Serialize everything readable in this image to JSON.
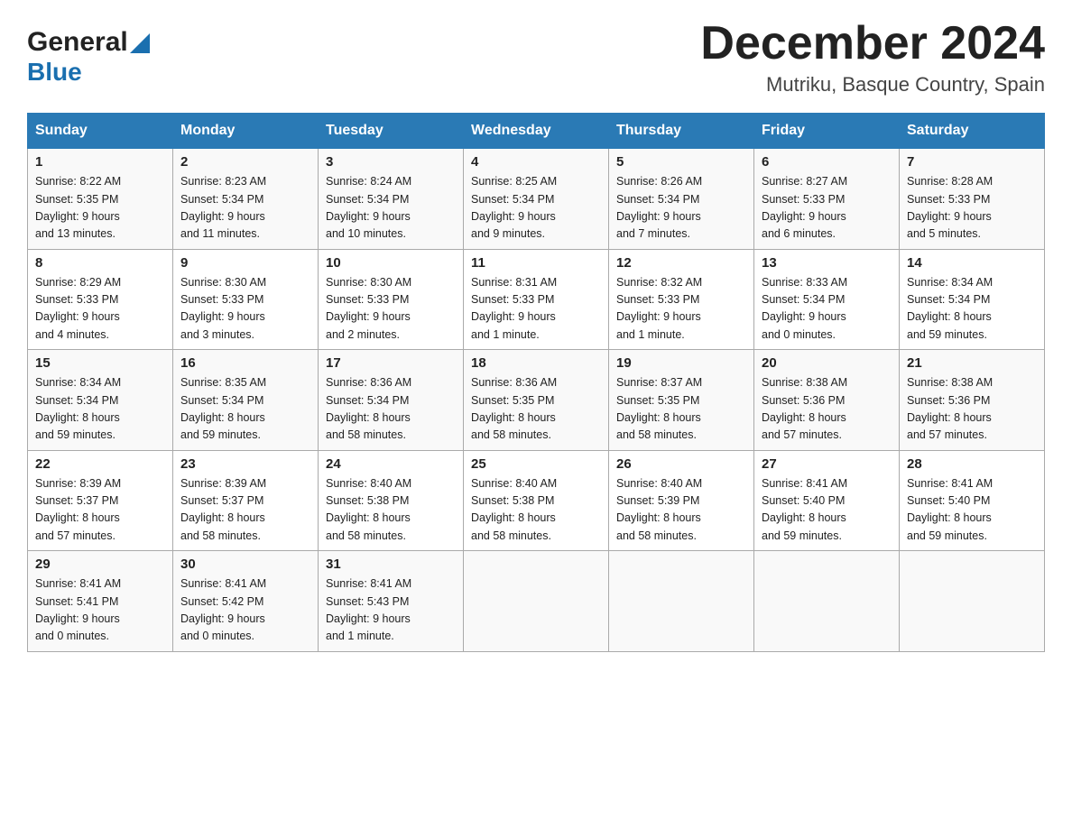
{
  "header": {
    "logo_general": "General",
    "logo_blue": "Blue",
    "month_title": "December 2024",
    "location": "Mutriku, Basque Country, Spain"
  },
  "days_of_week": [
    "Sunday",
    "Monday",
    "Tuesday",
    "Wednesday",
    "Thursday",
    "Friday",
    "Saturday"
  ],
  "weeks": [
    [
      {
        "day": "1",
        "sunrise": "8:22 AM",
        "sunset": "5:35 PM",
        "daylight": "9 hours and 13 minutes."
      },
      {
        "day": "2",
        "sunrise": "8:23 AM",
        "sunset": "5:34 PM",
        "daylight": "9 hours and 11 minutes."
      },
      {
        "day": "3",
        "sunrise": "8:24 AM",
        "sunset": "5:34 PM",
        "daylight": "9 hours and 10 minutes."
      },
      {
        "day": "4",
        "sunrise": "8:25 AM",
        "sunset": "5:34 PM",
        "daylight": "9 hours and 9 minutes."
      },
      {
        "day": "5",
        "sunrise": "8:26 AM",
        "sunset": "5:34 PM",
        "daylight": "9 hours and 7 minutes."
      },
      {
        "day": "6",
        "sunrise": "8:27 AM",
        "sunset": "5:33 PM",
        "daylight": "9 hours and 6 minutes."
      },
      {
        "day": "7",
        "sunrise": "8:28 AM",
        "sunset": "5:33 PM",
        "daylight": "9 hours and 5 minutes."
      }
    ],
    [
      {
        "day": "8",
        "sunrise": "8:29 AM",
        "sunset": "5:33 PM",
        "daylight": "9 hours and 4 minutes."
      },
      {
        "day": "9",
        "sunrise": "8:30 AM",
        "sunset": "5:33 PM",
        "daylight": "9 hours and 3 minutes."
      },
      {
        "day": "10",
        "sunrise": "8:30 AM",
        "sunset": "5:33 PM",
        "daylight": "9 hours and 2 minutes."
      },
      {
        "day": "11",
        "sunrise": "8:31 AM",
        "sunset": "5:33 PM",
        "daylight": "9 hours and 1 minute."
      },
      {
        "day": "12",
        "sunrise": "8:32 AM",
        "sunset": "5:33 PM",
        "daylight": "9 hours and 1 minute."
      },
      {
        "day": "13",
        "sunrise": "8:33 AM",
        "sunset": "5:34 PM",
        "daylight": "9 hours and 0 minutes."
      },
      {
        "day": "14",
        "sunrise": "8:34 AM",
        "sunset": "5:34 PM",
        "daylight": "8 hours and 59 minutes."
      }
    ],
    [
      {
        "day": "15",
        "sunrise": "8:34 AM",
        "sunset": "5:34 PM",
        "daylight": "8 hours and 59 minutes."
      },
      {
        "day": "16",
        "sunrise": "8:35 AM",
        "sunset": "5:34 PM",
        "daylight": "8 hours and 59 minutes."
      },
      {
        "day": "17",
        "sunrise": "8:36 AM",
        "sunset": "5:34 PM",
        "daylight": "8 hours and 58 minutes."
      },
      {
        "day": "18",
        "sunrise": "8:36 AM",
        "sunset": "5:35 PM",
        "daylight": "8 hours and 58 minutes."
      },
      {
        "day": "19",
        "sunrise": "8:37 AM",
        "sunset": "5:35 PM",
        "daylight": "8 hours and 58 minutes."
      },
      {
        "day": "20",
        "sunrise": "8:38 AM",
        "sunset": "5:36 PM",
        "daylight": "8 hours and 57 minutes."
      },
      {
        "day": "21",
        "sunrise": "8:38 AM",
        "sunset": "5:36 PM",
        "daylight": "8 hours and 57 minutes."
      }
    ],
    [
      {
        "day": "22",
        "sunrise": "8:39 AM",
        "sunset": "5:37 PM",
        "daylight": "8 hours and 57 minutes."
      },
      {
        "day": "23",
        "sunrise": "8:39 AM",
        "sunset": "5:37 PM",
        "daylight": "8 hours and 58 minutes."
      },
      {
        "day": "24",
        "sunrise": "8:40 AM",
        "sunset": "5:38 PM",
        "daylight": "8 hours and 58 minutes."
      },
      {
        "day": "25",
        "sunrise": "8:40 AM",
        "sunset": "5:38 PM",
        "daylight": "8 hours and 58 minutes."
      },
      {
        "day": "26",
        "sunrise": "8:40 AM",
        "sunset": "5:39 PM",
        "daylight": "8 hours and 58 minutes."
      },
      {
        "day": "27",
        "sunrise": "8:41 AM",
        "sunset": "5:40 PM",
        "daylight": "8 hours and 59 minutes."
      },
      {
        "day": "28",
        "sunrise": "8:41 AM",
        "sunset": "5:40 PM",
        "daylight": "8 hours and 59 minutes."
      }
    ],
    [
      {
        "day": "29",
        "sunrise": "8:41 AM",
        "sunset": "5:41 PM",
        "daylight": "9 hours and 0 minutes."
      },
      {
        "day": "30",
        "sunrise": "8:41 AM",
        "sunset": "5:42 PM",
        "daylight": "9 hours and 0 minutes."
      },
      {
        "day": "31",
        "sunrise": "8:41 AM",
        "sunset": "5:43 PM",
        "daylight": "9 hours and 1 minute."
      },
      null,
      null,
      null,
      null
    ]
  ],
  "labels": {
    "sunrise": "Sunrise:",
    "sunset": "Sunset:",
    "daylight": "Daylight:"
  }
}
